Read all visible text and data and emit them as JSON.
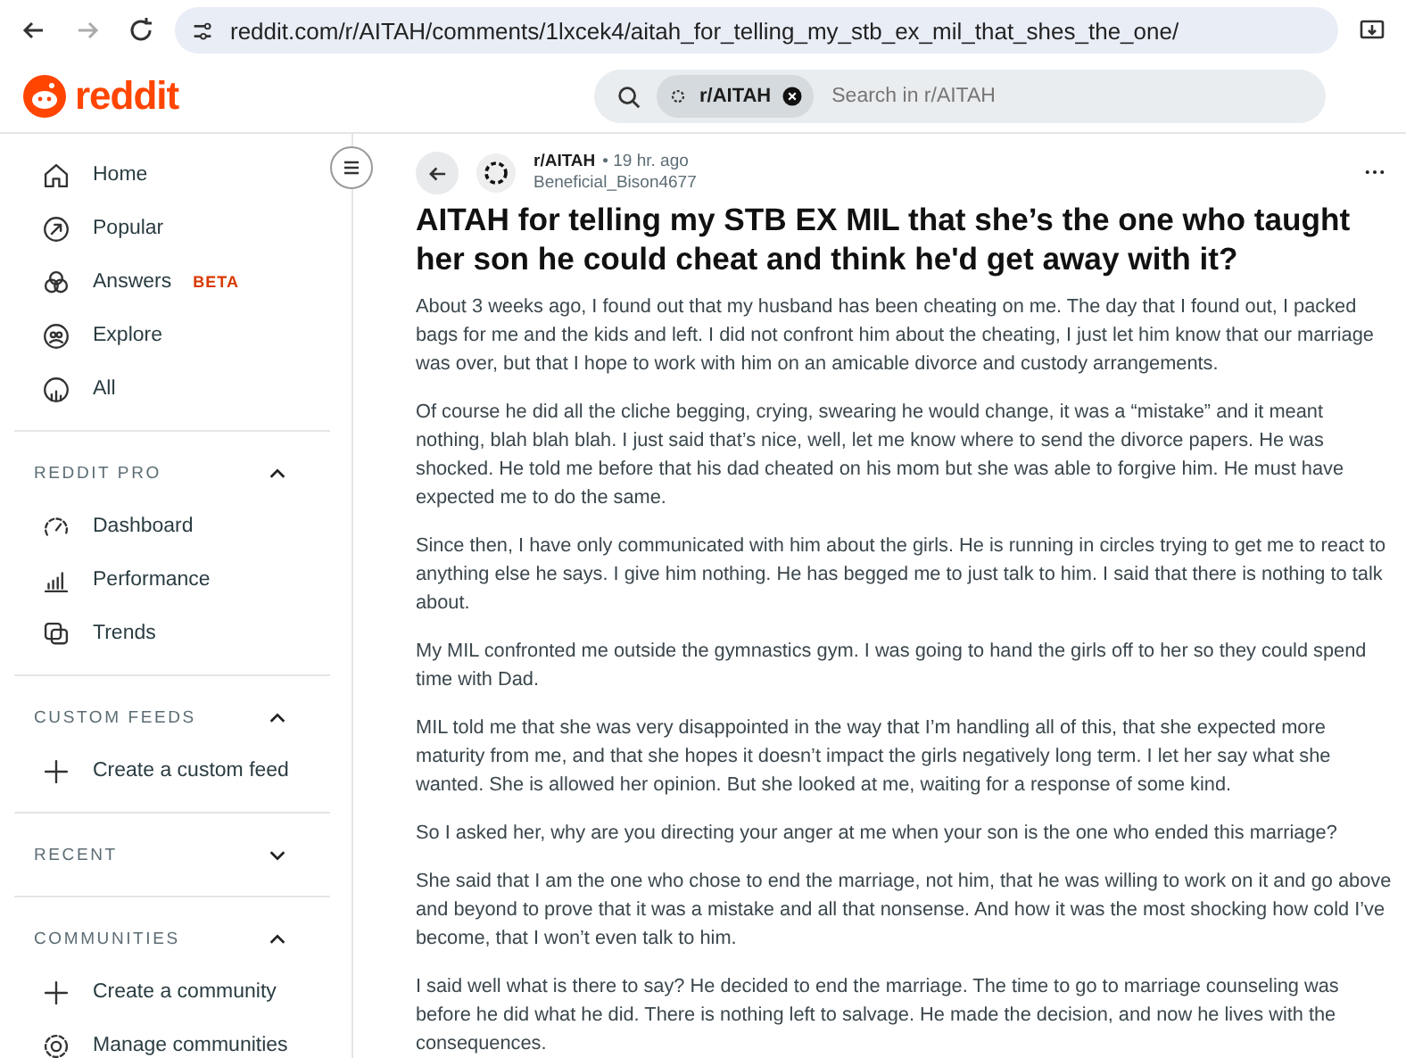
{
  "browser": {
    "url": "reddit.com/r/AITAH/comments/1lxcek4/aitah_for_telling_my_stb_ex_mil_that_shes_the_one/"
  },
  "header": {
    "logo": "reddit",
    "search_chip": "r/AITAH",
    "search_placeholder": "Search in r/AITAH"
  },
  "sidebar": {
    "items": [
      {
        "kind": "home",
        "label": "Home"
      },
      {
        "kind": "popular",
        "label": "Popular"
      },
      {
        "kind": "answers",
        "label": "Answers",
        "badge": "BETA"
      },
      {
        "kind": "explore",
        "label": "Explore"
      },
      {
        "kind": "all",
        "label": "All"
      }
    ],
    "sections": [
      {
        "title": "REDDIT PRO",
        "expanded": true,
        "items": [
          {
            "kind": "dashboard",
            "label": "Dashboard"
          },
          {
            "kind": "performance",
            "label": "Performance"
          },
          {
            "kind": "trends",
            "label": "Trends"
          }
        ]
      },
      {
        "title": "CUSTOM FEEDS",
        "expanded": true,
        "items": [
          {
            "kind": "plus",
            "label": "Create a custom feed"
          }
        ]
      },
      {
        "title": "RECENT",
        "expanded": false
      },
      {
        "title": "COMMUNITIES",
        "expanded": true,
        "items": [
          {
            "kind": "plus",
            "label": "Create a community"
          },
          {
            "kind": "gear",
            "label": "Manage communities"
          }
        ]
      }
    ]
  },
  "post": {
    "subreddit": "r/AITAH",
    "time": "• 19 hr. ago",
    "author": "Beneficial_Bison4677",
    "title": "AITAH for telling my STB EX MIL that she’s the one who taught her son he could cheat and think he'd get away with it?",
    "paragraphs": [
      "About 3 weeks ago, I found out that my husband has been cheating on me. The day that I found out, I packed bags for me and the kids and left. I did not confront him about the cheating, I just let him know that our marriage was over, but that I hope to work with him on an amicable divorce and custody arrangements.",
      "Of course he did all the cliche begging, crying, swearing he would change, it was a “mistake” and it meant nothing, blah blah blah. I just said that’s nice, well, let me know where to send the divorce papers. He was shocked. He told me before that his dad cheated on his mom but she was able to forgive him. He must have expected me to do the same.",
      "Since then, I have only communicated with him about the girls. He is running in circles trying to get me to react to anything else he says. I give him nothing. He has begged me to just talk to him. I said that there is nothing to talk about.",
      "My MIL confronted me outside the gymnastics gym. I was going to hand the girls off to her so they could spend time with Dad.",
      "MIL told me that she was very disappointed in the way that I’m handling all of this, that she expected more maturity from me, and that she hopes it doesn’t impact the girls negatively long term. I let her say what she wanted. She is allowed her opinion. But she looked at me, waiting for a response of some kind.",
      "So I asked her, why are you directing your anger at me when your son is the one who ended this marriage?",
      "She said that I am the one who chose to end the marriage, not him, that he was willing to work on it and go above and beyond to prove that it was a mistake and all that nonsense. And how it was the most shocking how cold I’ve become, that I won’t even talk to him.",
      "I said well what is there to say? He decided to end the marriage. The time to go to marriage counseling was before he did what he did. There is nothing left to salvage. He made the decision, and now he lives with the consequences."
    ]
  }
}
